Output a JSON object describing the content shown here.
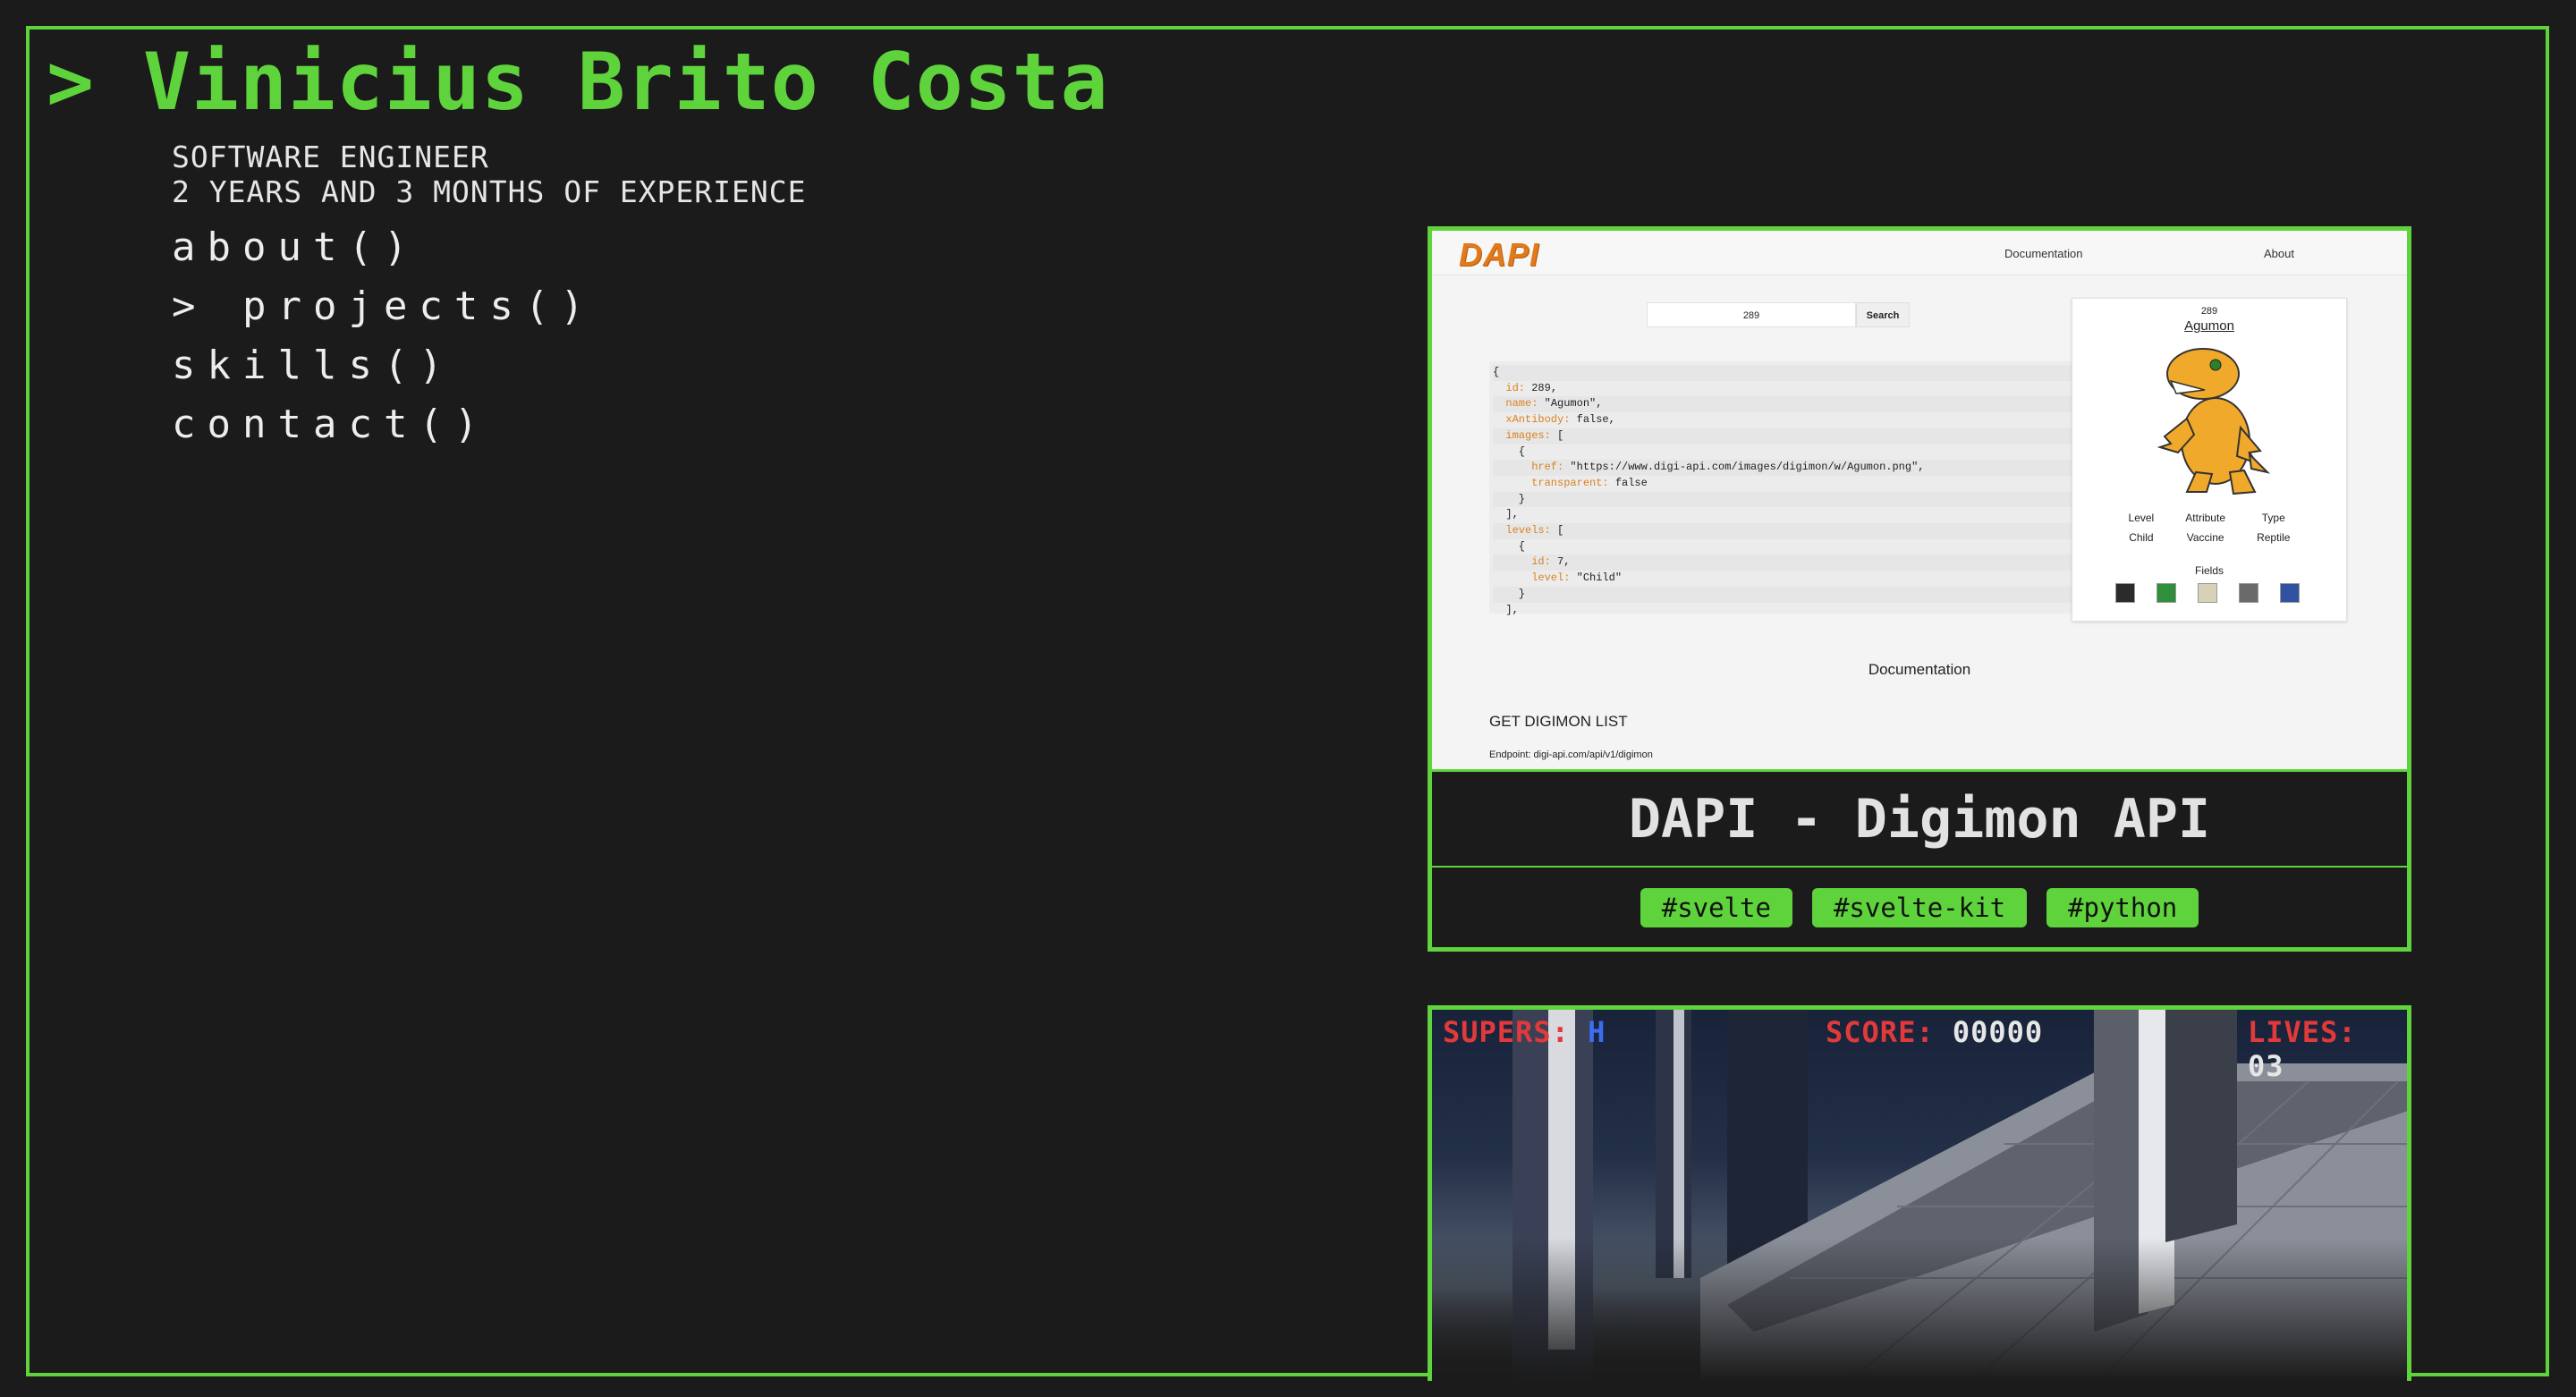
{
  "header": {
    "prompt": ">",
    "name": "Vinicius Brito Costa",
    "role": "SOFTWARE ENGINEER",
    "experience": "2 YEARS AND 3 MONTHS OF EXPERIENCE"
  },
  "nav": {
    "items": [
      {
        "label": "about()"
      },
      {
        "label": "> projects()",
        "active": true
      },
      {
        "label": "skills()"
      },
      {
        "label": "contact()"
      }
    ]
  },
  "projects": [
    {
      "title": "DAPI - Digimon API",
      "tags": [
        "#svelte",
        "#svelte-kit",
        "#python"
      ],
      "screenshot": {
        "logo": "DAPI",
        "links": [
          "Documentation",
          "About"
        ],
        "search_value": "289",
        "search_button": "Search",
        "json_lines": [
          {
            "t": "{"
          },
          {
            "k": "  id:",
            "v": " 289,"
          },
          {
            "k": "  name:",
            "v": " \"Agumon\","
          },
          {
            "k": "  xAntibody:",
            "v": " false,"
          },
          {
            "k": "  images:",
            "v": " ["
          },
          {
            "t": "    {"
          },
          {
            "k": "      href:",
            "v": " \"https://www.digi-api.com/images/digimon/w/Agumon.png\","
          },
          {
            "k": "      transparent:",
            "v": " false"
          },
          {
            "t": "    }"
          },
          {
            "t": "  ],"
          },
          {
            "k": "  levels:",
            "v": " ["
          },
          {
            "t": "    {"
          },
          {
            "k": "      id:",
            "v": " 7,"
          },
          {
            "k": "      level:",
            "v": " \"Child\""
          },
          {
            "t": "    }"
          },
          {
            "t": "  ],"
          }
        ],
        "digimon": {
          "id": "289",
          "name": "Agumon",
          "headers": [
            "Level",
            "Attribute",
            "Type"
          ],
          "values": [
            "Child",
            "Vaccine",
            "Reptile"
          ],
          "fields_label": "Fields",
          "field_colors": [
            "#2b2b2b",
            "#2f8f3a",
            "#d7d1b8",
            "#6a6a6a",
            "#3152a0"
          ]
        },
        "doc_heading": "Documentation",
        "section": "GET DIGIMON LIST",
        "endpoint": "Endpoint: digi-api.com/api/v1/digimon"
      }
    },
    {
      "screenshot": {
        "hud": {
          "supers_label": "SUPERS:",
          "supers_value": "H",
          "score_label": "SCORE:",
          "score_value": "00000",
          "lives_label": "LIVES:",
          "lives_value": "03"
        }
      }
    }
  ],
  "colors": {
    "accent": "#5ed33b",
    "background": "#1b1b1b",
    "hud_red": "#e23a3a",
    "hud_blue": "#3b6df0"
  }
}
